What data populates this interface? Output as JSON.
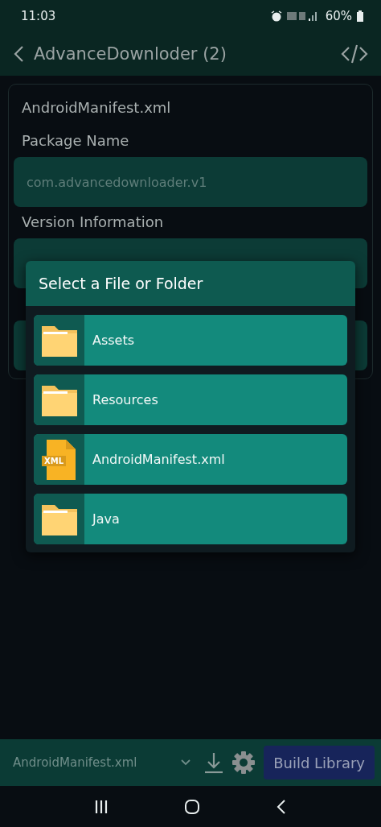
{
  "status_bar": {
    "time": "11:03",
    "battery": "60%"
  },
  "app_bar": {
    "title": "AdvanceDownloder (2)"
  },
  "form": {
    "file_name": "AndroidManifest.xml",
    "fields": [
      {
        "label": "Package Name",
        "value": "com.advancedownloader.v1"
      },
      {
        "label": "Version Information"
      },
      {
        "covered": true
      }
    ]
  },
  "dialog": {
    "title": "Select a File or Folder",
    "items": [
      {
        "kind": "folder",
        "name": "Assets"
      },
      {
        "kind": "folder",
        "name": "Resources"
      },
      {
        "kind": "xml",
        "name": "AndroidManifest.xml",
        "badge": "XML"
      },
      {
        "kind": "folder",
        "name": "Java"
      }
    ]
  },
  "bottom_bar": {
    "file_select": "AndroidManifest.xml",
    "build_button": "Build Library"
  }
}
